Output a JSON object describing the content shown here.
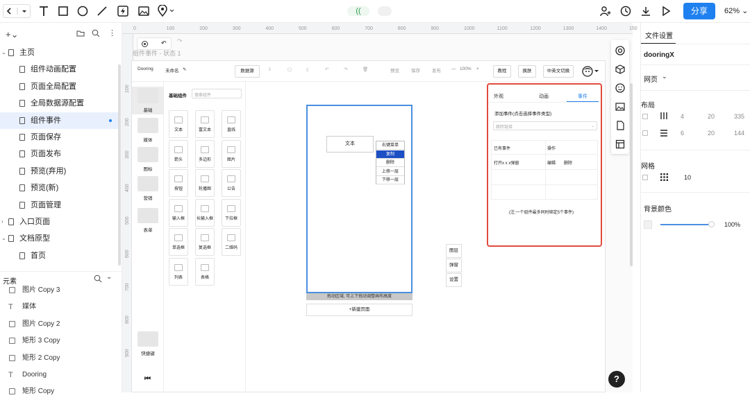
{
  "topbar": {
    "share_label": "分享",
    "zoom": "62%",
    "status": "(("
  },
  "left_panel": {
    "pages": [
      {
        "label": "主页",
        "level": 0,
        "expanded": true
      },
      {
        "label": "组件动画配置",
        "level": 1
      },
      {
        "label": "页面全局配置",
        "level": 1
      },
      {
        "label": "全局数据源配置",
        "level": 1
      },
      {
        "label": "组件事件",
        "level": 1,
        "selected": true
      },
      {
        "label": "页面保存",
        "level": 1
      },
      {
        "label": "页面发布",
        "level": 1
      },
      {
        "label": "预览(弃用)",
        "level": 1
      },
      {
        "label": "预览(新)",
        "level": 1
      },
      {
        "label": "页面管理",
        "level": 1
      },
      {
        "label": "入口页面",
        "level": 0
      },
      {
        "label": "文档原型",
        "level": 0,
        "expanded": true
      },
      {
        "label": "首页",
        "level": 1
      }
    ],
    "elements_title": "元素",
    "elements": [
      {
        "label": "图片 Copy 3",
        "icon": "image-icon"
      },
      {
        "label": "媒体",
        "icon": "text-icon"
      },
      {
        "label": "图片 Copy 2",
        "icon": "image-icon"
      },
      {
        "label": "矩形 3 Copy",
        "icon": "rect-icon"
      },
      {
        "label": "矩形 2 Copy",
        "icon": "rect-icon"
      },
      {
        "label": "Dooring",
        "icon": "text-icon"
      },
      {
        "label": "矩形 Copy",
        "icon": "rect-icon"
      }
    ]
  },
  "rulers": {
    "top": [
      "0",
      "100",
      "200",
      "300",
      "400",
      "500",
      "600",
      "700",
      "800",
      "900",
      "1000",
      "1100",
      "1200",
      "1300",
      "1400",
      "150"
    ],
    "left": [
      "100",
      "200",
      "300",
      "400",
      "500",
      "600",
      "700",
      "800",
      "900"
    ]
  },
  "canvas": {
    "frame_title": "组件事件 - 状态 1"
  },
  "app": {
    "logo": "Dooring",
    "doc_name": "未命名",
    "toolbar": {
      "datasource": "数据源",
      "preview": "预览",
      "save": "保存",
      "publish": "发布",
      "zoom": "100%",
      "tutorial": "教程",
      "skin": "换肤",
      "lang": "中英文切换"
    },
    "categories": [
      "基础",
      "媒体",
      "图标",
      "营销",
      "表单",
      "快捷键"
    ],
    "comp_header": "基础组件",
    "comp_search_placeholder": "搜索组件",
    "components": [
      "文本",
      "富文本",
      "直线",
      "箭头",
      "多边形",
      "图片",
      "按钮",
      "轮播图",
      "公告",
      "输入框",
      "长输入框",
      "下拉框",
      "单选框",
      "复选框",
      "二维码",
      "列表",
      "表格"
    ],
    "canvas_text": "文本",
    "context_menu": [
      "右键菜单",
      "复制",
      "删除",
      "上移一层",
      "下移一层"
    ],
    "drag_tip": "拖动区域, 可上下拖动调整画布高度",
    "new_page": "+新建页面",
    "side_btns": [
      "图层",
      "弹窗",
      "设置"
    ],
    "event_panel": {
      "tabs": [
        "外观",
        "动画",
        "事件"
      ],
      "add_label": "添加事件(点击选择事件类型)",
      "select_placeholder": "跳转链接",
      "table_headers": [
        "已有事件",
        "操作"
      ],
      "rows": [
        {
          "event": "打开x x x弹窗",
          "edit": "编辑",
          "del": "删除"
        }
      ],
      "note": "(注:一个组件最多同时绑定5个事件)"
    }
  },
  "right_panel": {
    "tab": "文件设置",
    "project": "dooringX",
    "device": "网页",
    "layout_title": "布局",
    "layout_rows": [
      [
        "4",
        "20",
        "335"
      ],
      [
        "6",
        "20",
        "144"
      ]
    ],
    "grid_title": "网格",
    "grid_value": "10",
    "bg_title": "背景颜色",
    "bg_value": "100%"
  },
  "colors": {
    "accent": "#1f80f0",
    "highlight": "#e24a3b",
    "selected_row": "#e9f0fd"
  }
}
